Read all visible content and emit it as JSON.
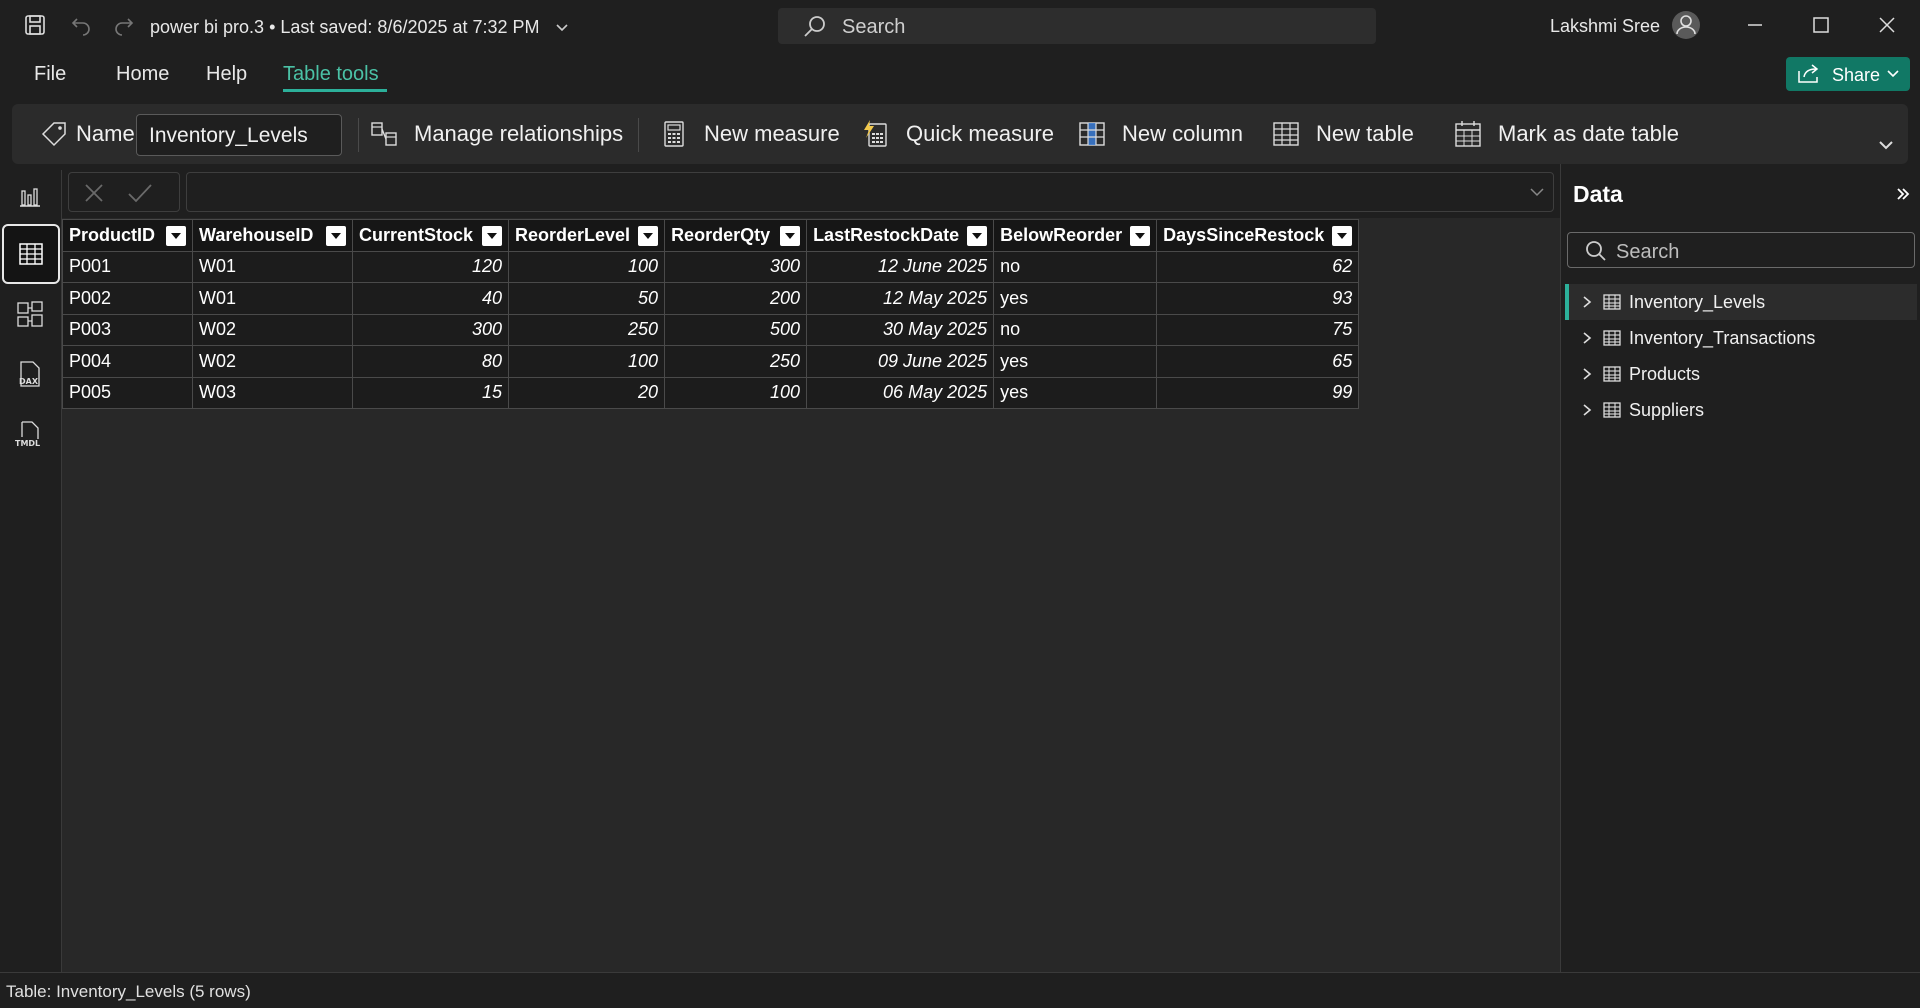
{
  "titlebar": {
    "doc_title": "power bi pro.3 • Last saved: 8/6/2025 at 7:32 PM",
    "search_label": "Search",
    "user_name": "Lakshmi Sree"
  },
  "menu": {
    "file": "File",
    "home": "Home",
    "help": "Help",
    "table_tools": "Table tools",
    "share": "Share"
  },
  "ribbon": {
    "name_label": "Name",
    "name_value": "Inventory_Levels",
    "manage_relationships": "Manage relationships",
    "new_measure": "New measure",
    "quick_measure": "Quick measure",
    "new_column": "New column",
    "new_table": "New table",
    "mark_as_date_table": "Mark as date table"
  },
  "table": {
    "columns": [
      "ProductID",
      "WarehouseID",
      "CurrentStock",
      "ReorderLevel",
      "ReorderQty",
      "LastRestockDate",
      "BelowReorder",
      "DaysSinceRestock"
    ],
    "rows": [
      [
        "P001",
        "W01",
        "120",
        "100",
        "300",
        "12 June 2025",
        "no",
        "62"
      ],
      [
        "P002",
        "W01",
        "40",
        "50",
        "200",
        "12 May 2025",
        "yes",
        "93"
      ],
      [
        "P003",
        "W02",
        "300",
        "250",
        "500",
        "30 May 2025",
        "no",
        "75"
      ],
      [
        "P004",
        "W02",
        "80",
        "100",
        "250",
        "09 June 2025",
        "yes",
        "65"
      ],
      [
        "P005",
        "W03",
        "15",
        "20",
        "100",
        "06 May 2025",
        "yes",
        "99"
      ]
    ]
  },
  "data_pane": {
    "title": "Data",
    "search_placeholder": "Search",
    "tables": [
      "Inventory_Levels",
      "Inventory_Transactions",
      "Products",
      "Suppliers"
    ]
  },
  "status": {
    "text": "Table: Inventory_Levels (5 rows)"
  },
  "colors": {
    "accent": "#2cb09a",
    "share_button": "#117865",
    "background": "#1f1f1f"
  }
}
